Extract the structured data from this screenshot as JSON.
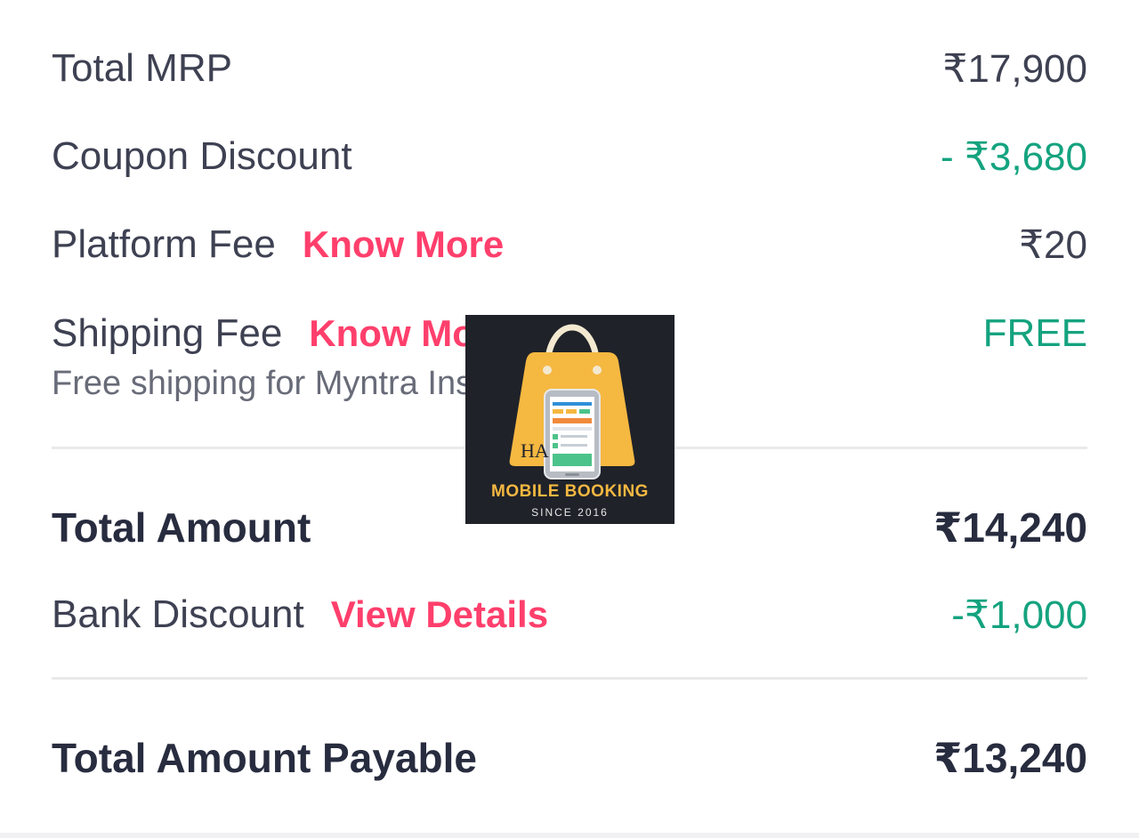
{
  "rows": {
    "total_mrp": {
      "label": "Total MRP",
      "value": "₹17,900"
    },
    "coupon_discount": {
      "label": "Coupon Discount",
      "value": "- ₹3,680"
    },
    "platform_fee": {
      "label": "Platform Fee",
      "link": "Know More",
      "value": "₹20"
    },
    "shipping_fee": {
      "label": "Shipping Fee",
      "link": "Know More",
      "value": "FREE",
      "note": "Free shipping for Myntra Insider"
    },
    "total_amount": {
      "label": "Total Amount",
      "value": "₹14,240"
    },
    "bank_discount": {
      "label": "Bank Discount",
      "link": "View Details",
      "value": "-₹1,000"
    },
    "total_payable": {
      "label": "Total Amount Payable",
      "value": "₹13,240"
    }
  },
  "watermark": {
    "title": "MOBILE BOOKING",
    "subtitle": "SINCE 2016",
    "initials": "HA"
  },
  "colors": {
    "accent_pink": "#ff3f6c",
    "green": "#14a37f",
    "text": "#3e4152",
    "logo_bg": "#1f2229",
    "bag": "#f5b841"
  }
}
